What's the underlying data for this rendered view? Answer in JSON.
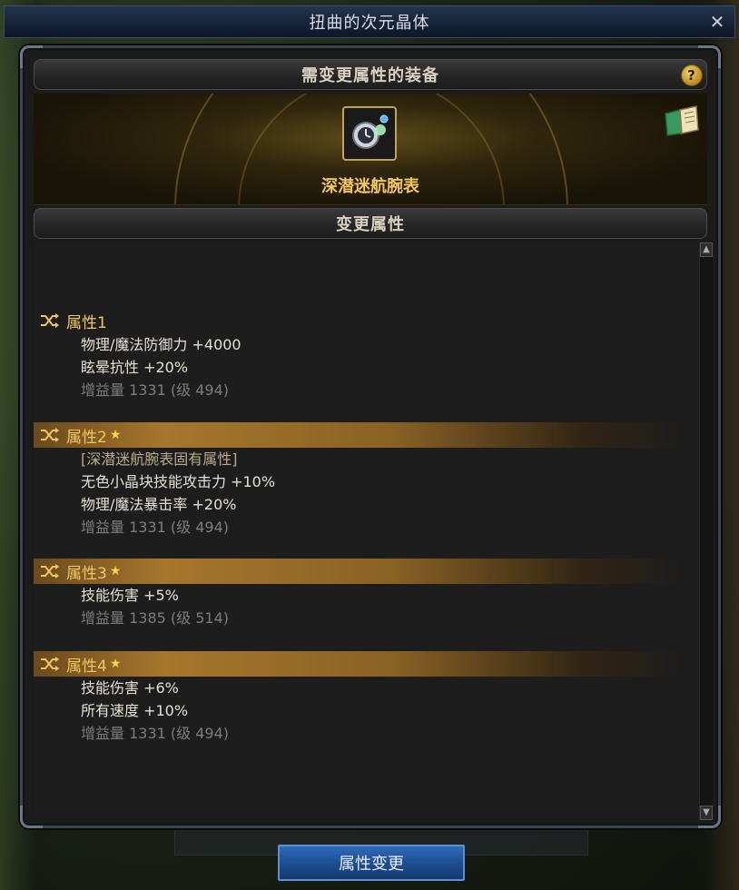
{
  "window": {
    "title": "扭曲的次元晶体",
    "close_glyph": "✕"
  },
  "equipment_section": {
    "header": "需变更属性的装备",
    "help_glyph": "?",
    "item_name": "深潜迷航腕表",
    "item_icon": "wristwatch-icon",
    "guide_icon": "book-icon"
  },
  "change_section": {
    "header": "变更属性"
  },
  "properties": [
    {
      "label": "属性1",
      "starred": false,
      "highlighted": false,
      "lines": [
        "物理/魔法防御力 +4000",
        "眩晕抗性 +20%"
      ],
      "gain": "增益量 1331 (级 494)"
    },
    {
      "label": "属性2",
      "starred": true,
      "highlighted": true,
      "inherent": "[深潜迷航腕表固有属性]",
      "lines": [
        "无色小晶块技能攻击力 +10%",
        "物理/魔法暴击率 +20%"
      ],
      "gain": "增益量 1331 (级 494)"
    },
    {
      "label": "属性3",
      "starred": true,
      "highlighted": true,
      "lines": [
        "技能伤害 +5%"
      ],
      "gain": "增益量 1385 (级 514)"
    },
    {
      "label": "属性4",
      "starred": true,
      "highlighted": true,
      "lines": [
        "技能伤害 +6%",
        "所有速度 +10%"
      ],
      "gain": "增益量 1331 (级 494)"
    }
  ],
  "star_glyph": "★",
  "action_button": {
    "label": "属性变更"
  },
  "colors": {
    "accent_gold": "#f2c660",
    "button_blue": "#1d4c8e"
  }
}
